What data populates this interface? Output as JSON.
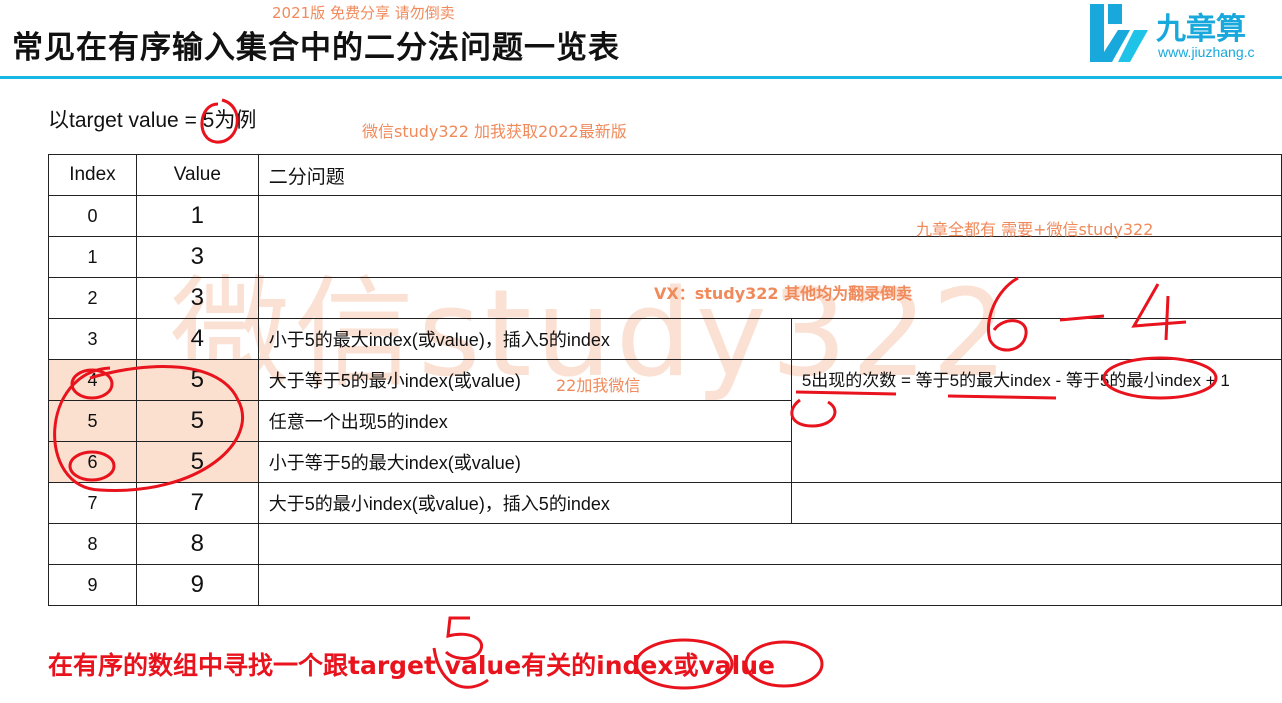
{
  "header": {
    "title": "常见在有序输入集合中的二分法问题一览表",
    "logo_text": "九章算",
    "logo_url": "www.jiuzhang.c"
  },
  "watermarks": {
    "top": "2021版 免费分享 请勿倒卖",
    "wechat": "微信study322 加我获取2022最新版",
    "all_have": "九章全都有 需要+微信study322",
    "vx": "VX：study322 其他均为翻录倒卖",
    "big": "微信study322",
    "mid": "22加我微信"
  },
  "subtitle": "以target value = 5为例",
  "table": {
    "headers": [
      "Index",
      "Value",
      "二分问题"
    ],
    "rows": [
      {
        "index": "0",
        "value": "1",
        "question": ""
      },
      {
        "index": "1",
        "value": "3",
        "question": ""
      },
      {
        "index": "2",
        "value": "3",
        "question": ""
      },
      {
        "index": "3",
        "value": "4",
        "question": "小于5的最大index(或value)，插入5的index"
      },
      {
        "index": "4",
        "value": "5",
        "question": "大于等于5的最小index(或value)"
      },
      {
        "index": "5",
        "value": "5",
        "question": "任意一个出现5的index"
      },
      {
        "index": "6",
        "value": "5",
        "question": "小于等于5的最大index(或value)"
      },
      {
        "index": "7",
        "value": "7",
        "question": "大于5的最小index(或value)，插入5的index"
      },
      {
        "index": "8",
        "value": "8",
        "question": ""
      },
      {
        "index": "9",
        "value": "9",
        "question": ""
      }
    ],
    "count_note": "5出现的次数 = 等于5的最大index - 等于5的最小index + 1"
  },
  "annotations": {
    "handwritten_top": "6 - 4",
    "handwritten_bottom": "5"
  },
  "bottom_text": "在有序的数组中寻找一个跟target value有关的index或value",
  "colors": {
    "accent_blue": "#18b6e3",
    "red": "#e8131d",
    "highlight": "#fbe0cf",
    "watermark": "#f08a5b"
  }
}
